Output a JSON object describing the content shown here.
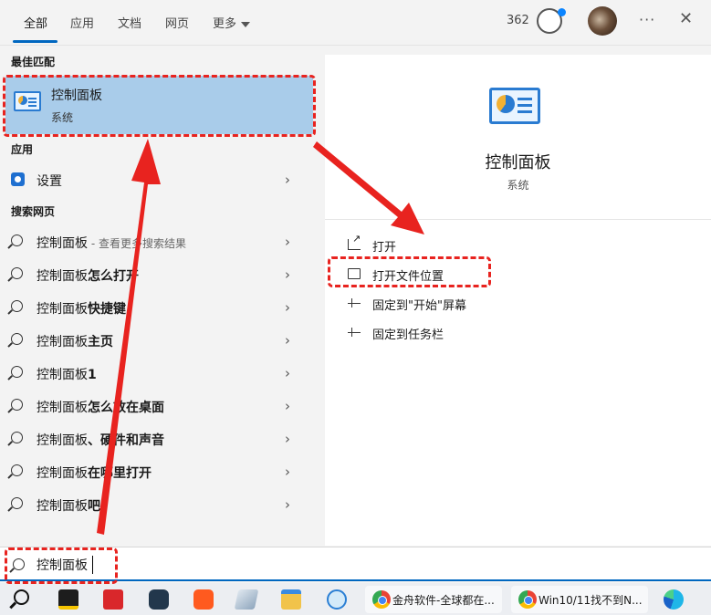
{
  "tabs": [
    {
      "label": "全部",
      "active": true
    },
    {
      "label": "应用"
    },
    {
      "label": "文档"
    },
    {
      "label": "网页"
    },
    {
      "label": "更多"
    }
  ],
  "header": {
    "points": "362",
    "more_icon": "more-dots-icon",
    "close_icon": "close-icon"
  },
  "left": {
    "best_match_heading": "最佳匹配",
    "best_match": {
      "title": "控制面板",
      "subtitle": "系统"
    },
    "apps_heading": "应用",
    "apps": [
      {
        "label": "设置"
      }
    ],
    "web_heading": "搜索网页",
    "web_items": [
      {
        "main": "控制面板",
        "bold": "",
        "hint": " - 查看更多搜索结果"
      },
      {
        "main": "控制面板",
        "bold": "怎么打开",
        "hint": ""
      },
      {
        "main": "控制面板",
        "bold": "快捷键",
        "hint": ""
      },
      {
        "main": "控制面板",
        "bold": "主页",
        "hint": ""
      },
      {
        "main": "控制面板",
        "bold": "1",
        "hint": ""
      },
      {
        "main": "控制面板",
        "bold": "怎么放在桌面",
        "hint": ""
      },
      {
        "main": "控制面板",
        "bold": "、硬件和声音",
        "hint": ""
      },
      {
        "main": "控制面板",
        "bold": "在哪里打开",
        "hint": ""
      },
      {
        "main": "控制面板",
        "bold": "吧",
        "hint": ""
      }
    ]
  },
  "right": {
    "title": "控制面板",
    "subtitle": "系统",
    "actions": [
      {
        "label": "打开",
        "icon": "open-icon"
      },
      {
        "label": "打开文件位置",
        "icon": "folder-icon"
      },
      {
        "label": "固定到\"开始\"屏幕",
        "icon": "pin-icon"
      },
      {
        "label": "固定到任务栏",
        "icon": "pin-icon"
      }
    ]
  },
  "search": {
    "value": "控制面板"
  },
  "taskbar": {
    "apps": [
      {
        "label": "金舟软件-全球都在..."
      },
      {
        "label": "Win10/11找不到N..."
      }
    ]
  },
  "colors": {
    "accent": "#0067c0",
    "highlight": "#a9ccea",
    "annotation": "#e8231f"
  }
}
